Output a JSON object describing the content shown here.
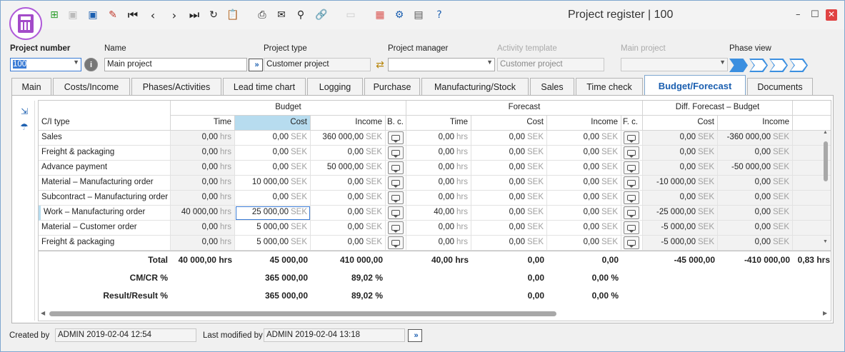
{
  "window": {
    "title": "Project register | 100",
    "minimize": "–",
    "maximize": "☐",
    "close": "✕"
  },
  "toolbar": [
    "new",
    "save",
    "save-as",
    "delete",
    "first",
    "prev",
    "next",
    "last",
    "refresh",
    "clipboard",
    "print",
    "mail",
    "search",
    "link",
    "blank",
    "apps",
    "settings",
    "library",
    "help"
  ],
  "fields": {
    "project_number_label": "Project number",
    "project_number": "100",
    "name_label": "Name",
    "name": "Main project",
    "project_type_label": "Project type",
    "project_type": "Customer project",
    "project_manager_label": "Project manager",
    "project_manager": "",
    "activity_template_label": "Activity template",
    "activity_template": "Customer project",
    "main_project_label": "Main project",
    "main_project": "",
    "phase_view_label": "Phase view",
    "info": "i",
    "go": "»"
  },
  "tabs": [
    "Main",
    "Costs/Income",
    "Phases/Activities",
    "Lead time chart",
    "Logging",
    "Purchase",
    "Manufacturing/Stock",
    "Sales",
    "Time check",
    "Budget/Forecast",
    "Documents"
  ],
  "active_tab": "Budget/Forecast",
  "groups": {
    "budget": "Budget",
    "forecast": "Forecast",
    "diff": "Diff. Forecast – Budget"
  },
  "columns": {
    "ci_type": "C/I type",
    "time": "Time",
    "cost": "Cost",
    "income": "Income",
    "bc": "B. c.",
    "fc": "F. c."
  },
  "units": {
    "hrs": "hrs",
    "sek": "SEK"
  },
  "rows": [
    {
      "name": "Sales",
      "b_time": "0,00",
      "b_cost": "0,00",
      "b_income": "360 000,00",
      "f_time": "0,00",
      "f_cost": "0,00",
      "f_income": "0,00",
      "d_cost": "0,00",
      "d_income": "-360 000,00"
    },
    {
      "name": "Freight & packaging",
      "b_time": "0,00",
      "b_cost": "0,00",
      "b_income": "0,00",
      "f_time": "0,00",
      "f_cost": "0,00",
      "f_income": "0,00",
      "d_cost": "0,00",
      "d_income": "0,00"
    },
    {
      "name": "Advance payment",
      "b_time": "0,00",
      "b_cost": "0,00",
      "b_income": "50 000,00",
      "f_time": "0,00",
      "f_cost": "0,00",
      "f_income": "0,00",
      "d_cost": "0,00",
      "d_income": "-50 000,00"
    },
    {
      "name": "Material – Manufacturing order",
      "b_time": "0,00",
      "b_cost": "10 000,00",
      "b_income": "0,00",
      "f_time": "0,00",
      "f_cost": "0,00",
      "f_income": "0,00",
      "d_cost": "-10 000,00",
      "d_income": "0,00"
    },
    {
      "name": "Subcontract – Manufacturing order",
      "b_time": "0,00",
      "b_cost": "0,00",
      "b_income": "0,00",
      "f_time": "0,00",
      "f_cost": "0,00",
      "f_income": "0,00",
      "d_cost": "0,00",
      "d_income": "0,00"
    },
    {
      "name": "Work – Manufacturing order",
      "b_time": "40 000,00",
      "b_cost": "25 000,00",
      "b_income": "0,00",
      "f_time": "40,00",
      "f_cost": "0,00",
      "f_income": "0,00",
      "d_cost": "-25 000,00",
      "d_income": "0,00"
    },
    {
      "name": "Material – Customer order",
      "b_time": "0,00",
      "b_cost": "5 000,00",
      "b_income": "0,00",
      "f_time": "0,00",
      "f_cost": "0,00",
      "f_income": "0,00",
      "d_cost": "-5 000,00",
      "d_income": "0,00"
    },
    {
      "name": "Freight & packaging",
      "b_time": "0,00",
      "b_cost": "5 000,00",
      "b_income": "0,00",
      "f_time": "0,00",
      "f_cost": "0,00",
      "f_income": "0,00",
      "d_cost": "-5 000,00",
      "d_income": "0,00"
    }
  ],
  "summary": [
    {
      "label": "Total",
      "b_time": "40 000,00 hrs",
      "b_cost": "45 000,00",
      "b_income": "410 000,00",
      "f_time": "40,00 hrs",
      "f_cost": "0,00",
      "f_income": "0,00",
      "d_cost": "-45 000,00",
      "d_income": "-410 000,00",
      "d_extra": "0,83 hrs"
    },
    {
      "label": "CM/CR %",
      "b_time": "",
      "b_cost": "365 000,00",
      "b_income": "89,02 %",
      "f_time": "",
      "f_cost": "0,00",
      "f_income": "0,00 %",
      "d_cost": "",
      "d_income": "",
      "d_extra": ""
    },
    {
      "label": "Result/Result %",
      "b_time": "",
      "b_cost": "365 000,00",
      "b_income": "89,02 %",
      "f_time": "",
      "f_cost": "0,00",
      "f_income": "0,00 %",
      "d_cost": "",
      "d_income": "",
      "d_extra": ""
    }
  ],
  "footer": {
    "created_by_label": "Created by",
    "created_by": "ADMIN 2019-02-04 12:54",
    "modified_label": "Last modified by",
    "modified": "ADMIN 2019-02-04 13:18"
  }
}
